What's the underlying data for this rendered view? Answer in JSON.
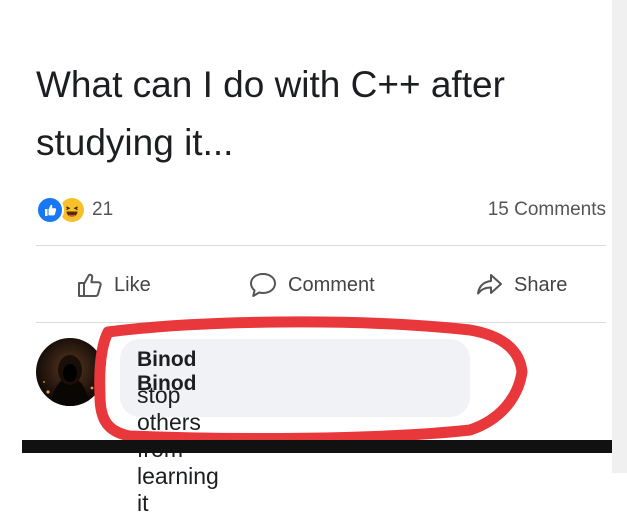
{
  "post": {
    "text": "What can I do with C++ after studying it..."
  },
  "reactions": {
    "count": "21",
    "types": [
      "like",
      "haha"
    ],
    "like_color": "#1877f2",
    "haha_color": "#f7c02b"
  },
  "comments_count_label": "15 Comments",
  "actions": {
    "like": "Like",
    "comment": "Comment",
    "share": "Share"
  },
  "comment": {
    "author": "Binod Binod",
    "text": "stop others from learning it"
  },
  "highlight_color": "#e8383b"
}
